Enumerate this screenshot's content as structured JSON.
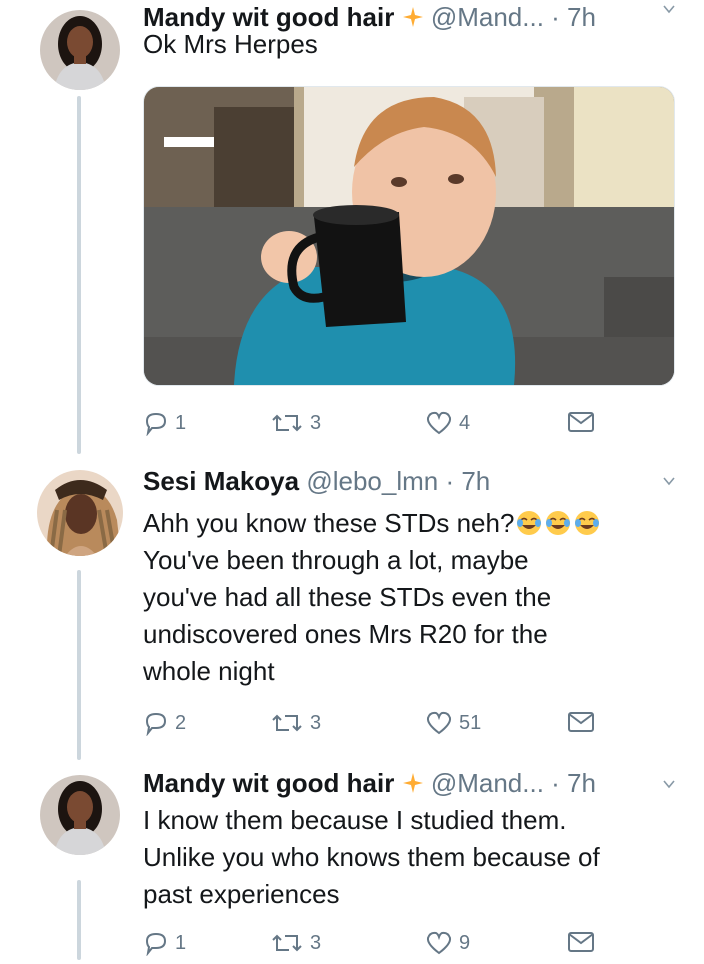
{
  "tweets": [
    {
      "name": "Mandy wit good hair",
      "handle": "@Mand...",
      "time": "· 7h",
      "text_lines": [
        "Ok Mrs Herpes"
      ],
      "has_media": true,
      "media_description": "",
      "replies": "1",
      "retweets": "3",
      "likes": "4"
    },
    {
      "name": "Sesi Makoya",
      "handle": "@lebo_lmn",
      "time": "· 7h",
      "text_lines": [
        "Ahh you know these STDs neh?",
        "You've been through a lot, maybe",
        "you've had  all these STDs even the",
        "undiscovered ones Mrs R20 for the",
        "whole night"
      ],
      "replies": "2",
      "retweets": "3",
      "likes": "51"
    },
    {
      "name": "Mandy wit good hair",
      "handle": "@Mand...",
      "time": "· 7h",
      "text_lines": [
        "I know them because I studied them.",
        "Unlike you who knows them because of",
        "past experiences"
      ],
      "replies": "1",
      "retweets": "3",
      "likes": "9"
    }
  ],
  "icons": {
    "reply": "reply-icon",
    "retweet": "retweet-icon",
    "like": "heart-icon",
    "dm": "envelope-icon",
    "emoji": "face-with-tears-of-joy-icon",
    "sparkles": "sparkles-icon",
    "caret": "chevron-down-icon"
  },
  "colors": {
    "text": "#14171a",
    "secondary": "#657786",
    "thread_line": "#ccd6dd",
    "sparkle": "#ffac33"
  }
}
